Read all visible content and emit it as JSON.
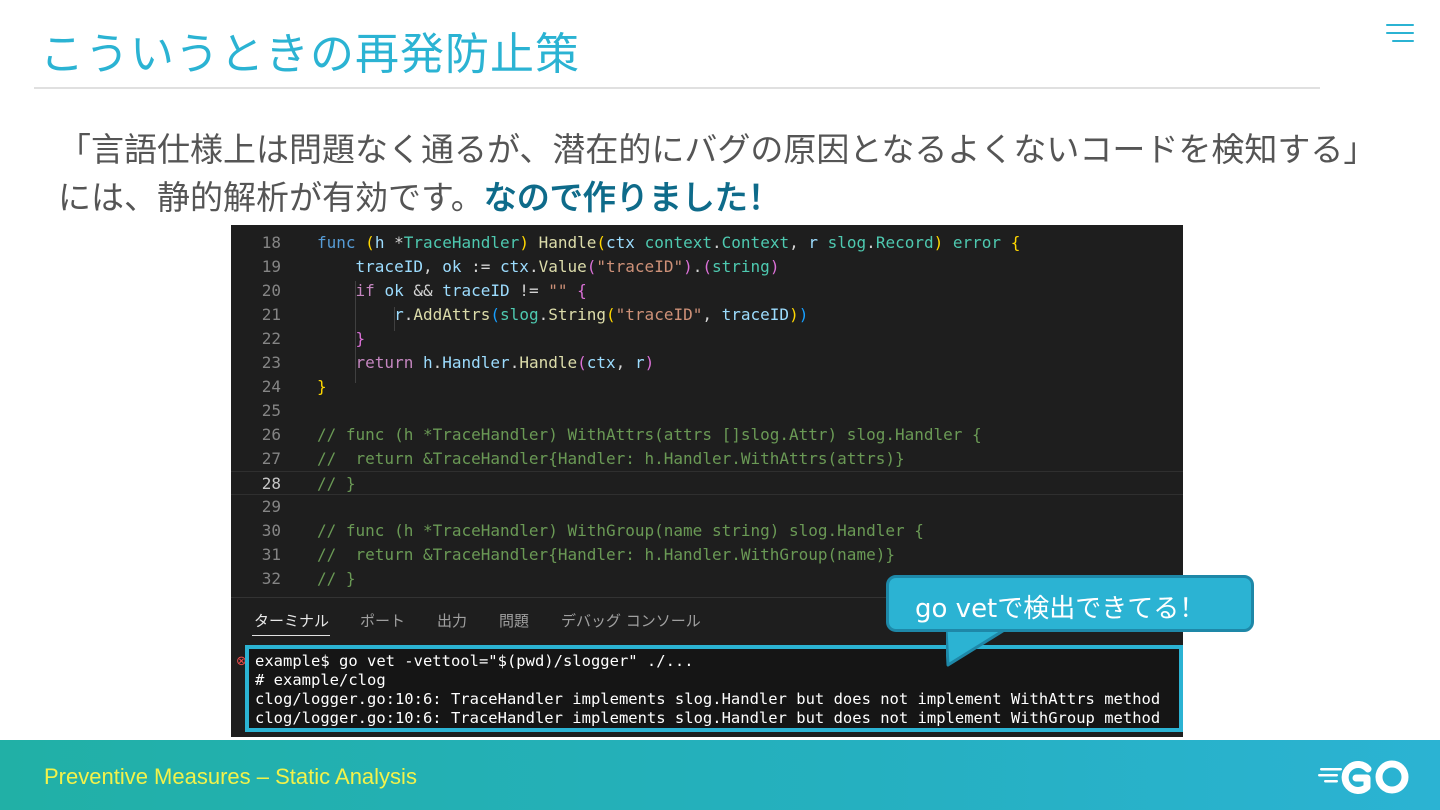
{
  "slide": {
    "title": "こういうときの再発防止策",
    "body_part1": "「言語仕様上は問題なく通るが、潜在的にバグの原因となるよくないコードを検知する」には、静的解析が有効です。",
    "body_emphasis": "なので作りました！",
    "callout": "go vetで検出できてる！",
    "footer": "Preventive Measures – Static Analysis",
    "menu_icon": "hamburger-menu-icon",
    "logo": "go-logo",
    "accent_color": "#2bb3d3",
    "footer_text_color": "#f2f24a"
  },
  "editor": {
    "current_line": "28",
    "lines": [
      {
        "n": "18",
        "text": "func (h *TraceHandler) Handle(ctx context.Context, r slog.Record) error {"
      },
      {
        "n": "19",
        "text": "traceID, ok := ctx.Value(\"traceID\").(string)"
      },
      {
        "n": "20",
        "text": "if ok && traceID != \"\" {"
      },
      {
        "n": "21",
        "text": "r.AddAttrs(slog.String(\"traceID\", traceID))"
      },
      {
        "n": "22",
        "text": "}"
      },
      {
        "n": "23",
        "text": "return h.Handler.Handle(ctx, r)"
      },
      {
        "n": "24",
        "text": "}"
      },
      {
        "n": "25",
        "text": ""
      },
      {
        "n": "26",
        "text": "// func (h *TraceHandler) WithAttrs(attrs []slog.Attr) slog.Handler {"
      },
      {
        "n": "27",
        "text": "//  return &TraceHandler{Handler: h.Handler.WithAttrs(attrs)}"
      },
      {
        "n": "28",
        "text": "// }"
      },
      {
        "n": "29",
        "text": ""
      },
      {
        "n": "30",
        "text": "// func (h *TraceHandler) WithGroup(name string) slog.Handler {"
      },
      {
        "n": "31",
        "text": "//  return &TraceHandler{Handler: h.Handler.WithGroup(name)}"
      },
      {
        "n": "32",
        "text": "// }"
      }
    ]
  },
  "panel": {
    "tabs": [
      "ターミナル",
      "ポート",
      "出力",
      "問題",
      "デバッグ コンソール"
    ],
    "active_tab": "ターミナル",
    "terminal_lines": [
      "example$ go vet -vettool=\"$(pwd)/slogger\" ./...",
      "# example/clog",
      "clog/logger.go:10:6: TraceHandler implements slog.Handler but does not implement WithAttrs method",
      "clog/logger.go:10:6: TraceHandler implements slog.Handler but does not implement WithGroup method"
    ],
    "error_icon": "error-circle-icon"
  }
}
